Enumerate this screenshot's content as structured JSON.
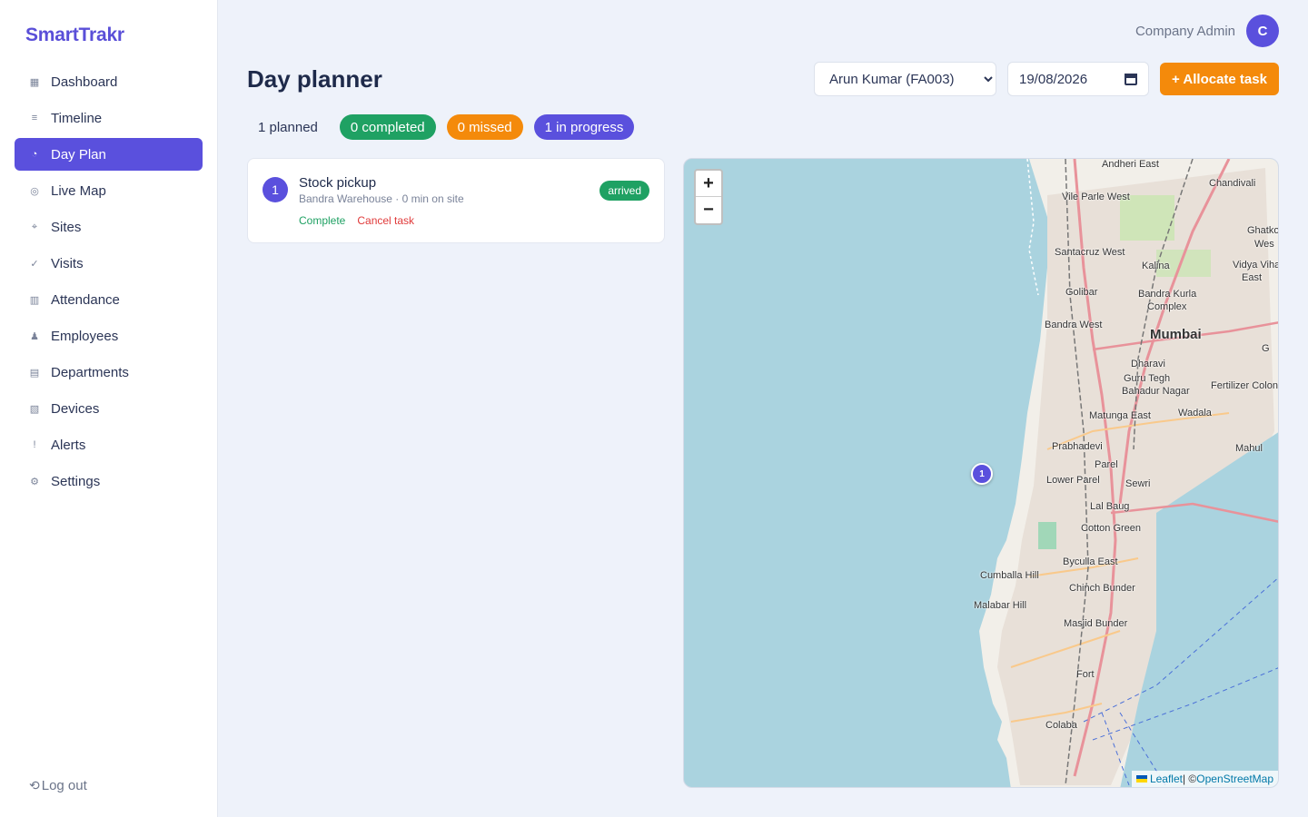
{
  "brand": "SmartTrakr",
  "sidebar": {
    "items": [
      {
        "icon": "▦",
        "label": "Dashboard"
      },
      {
        "icon": "≡",
        "label": "Timeline"
      },
      {
        "icon": "◔",
        "label": "Day Plan"
      },
      {
        "icon": "◎",
        "label": "Live Map"
      },
      {
        "icon": "⌖",
        "label": "Sites"
      },
      {
        "icon": "✓",
        "label": "Visits"
      },
      {
        "icon": "▥",
        "label": "Attendance"
      },
      {
        "icon": "♟",
        "label": "Employees"
      },
      {
        "icon": "▤",
        "label": "Departments"
      },
      {
        "icon": "▧",
        "label": "Devices"
      },
      {
        "icon": "!",
        "label": "Alerts"
      },
      {
        "icon": "⚙",
        "label": "Settings"
      }
    ],
    "active": "Day Plan",
    "logout_icon": "⟲",
    "logout_label": "Log out"
  },
  "header": {
    "user_name": "Company Admin",
    "avatar_initial": "C"
  },
  "page": {
    "title": "Day planner",
    "employee_select": "Arun Kumar (FA003)",
    "date_value": "19/08/2026",
    "allocate_label": "+ Allocate task"
  },
  "stats": {
    "planned": "1 planned",
    "completed": "0 completed",
    "missed": "0 missed",
    "in_progress": "1 in progress"
  },
  "tasks": [
    {
      "number": "1",
      "title": "Stock pickup",
      "subtitle": "Bandra Warehouse · 0 min on site",
      "status": "arrived",
      "complete_label": "Complete",
      "cancel_label": "Cancel task"
    }
  ],
  "map": {
    "zoom_in": "+",
    "zoom_out": "−",
    "marker_label": "1",
    "attribution_leaflet": "Leaflet",
    "attribution_sep": " | © ",
    "attribution_osm": "OpenStreetMap",
    "labels": {
      "andheri_east": "Andheri East",
      "chandivali": "Chandivali",
      "vile_parle_west": "Vile Parle West",
      "ghatko": "Ghatko",
      "wes": "Wes",
      "santacruz_west": "Santacruz West",
      "kalina": "Kalina",
      "vidya_viha": "Vidya Viha",
      "east": "East",
      "golibar": "Golibar",
      "bandra_kurla": "Bandra Kurla",
      "complex": "Complex",
      "bandra_west": "Bandra West",
      "mumbai": "Mumbai",
      "g": "G",
      "dharavi": "Dharavi",
      "guru_tegh": "Guru Tegh",
      "bahadur_nagar": "Bahadur Nagar",
      "fertilizer_colon": "Fertilizer Colon",
      "matunga_east": "Matunga East",
      "wadala": "Wadala",
      "prabhadevi": "Prabhadevi",
      "mahul": "Mahul",
      "parel": "Parel",
      "lower_parel": "Lower Parel",
      "sewri": "Sewri",
      "lal_baug": "Lal Baug",
      "cotton_green": "Cotton Green",
      "byculla_east": "Byculla East",
      "cumballa_hill": "Cumballa Hill",
      "chinch_bunder": "Chinch Bunder",
      "malabar_hill": "Malabar Hill",
      "masjid_bunder": "Masjid Bunder",
      "fort": "Fort",
      "colaba": "Colaba"
    },
    "colors": {
      "water": "#aad3df",
      "land": "#f2efe9",
      "urban": "#e8e0d8",
      "road_major": "#e8929a",
      "road_primary": "#f9c98b"
    }
  },
  "colors": {
    "accent": "#5a50dd",
    "orange": "#f48a0b",
    "green": "#1fa163",
    "red": "#e03a3a"
  }
}
